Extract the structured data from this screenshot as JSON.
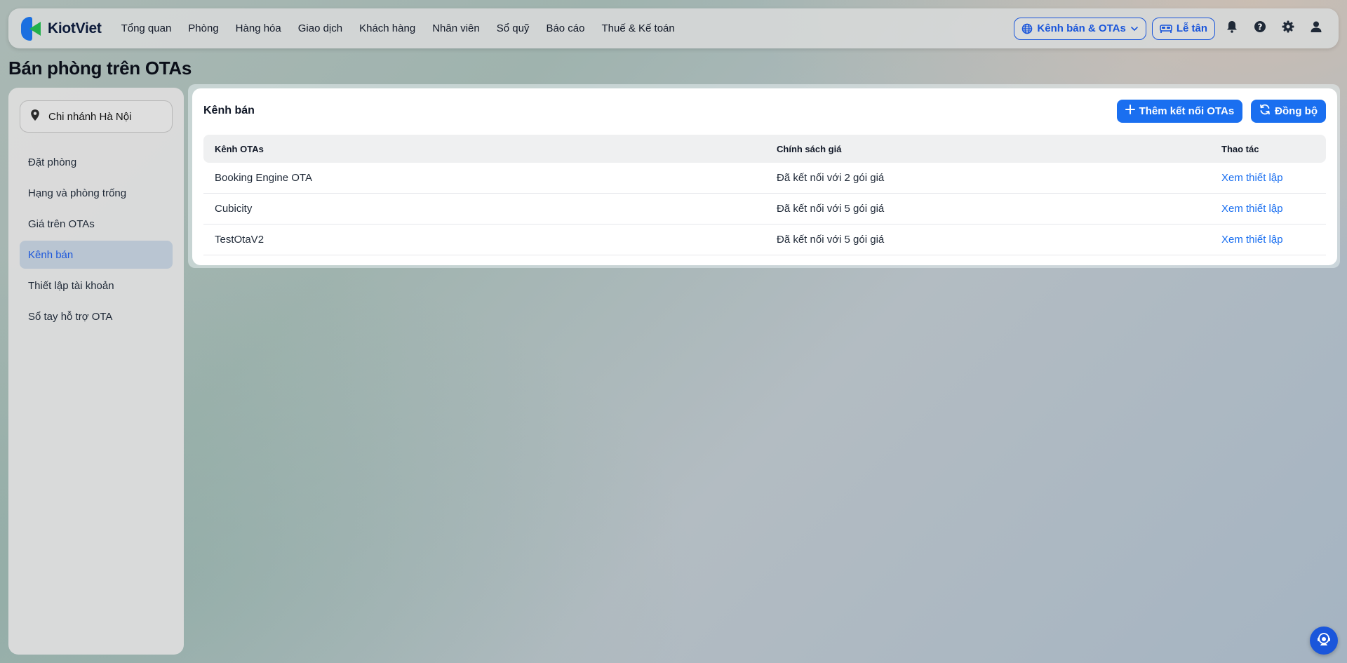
{
  "app": {
    "name": "KiotViet"
  },
  "nav": {
    "items": [
      "Tổng quan",
      "Phòng",
      "Hàng hóa",
      "Giao dịch",
      "Khách hàng",
      "Nhân viên",
      "Sổ quỹ",
      "Báo cáo",
      "Thuế & Kế toán"
    ]
  },
  "topright": {
    "channel_label": "Kênh bán & OTAs",
    "reception_label": "Lễ tân"
  },
  "page": {
    "title": "Bán phòng trên OTAs"
  },
  "sidebar": {
    "branch": "Chi nhánh Hà Nội",
    "items": [
      "Đặt phòng",
      "Hạng và phòng trống",
      "Giá trên OTAs",
      "Kênh bán",
      "Thiết lập tài khoản",
      "Sổ tay hỗ trợ OTA"
    ],
    "active_index": 3
  },
  "main": {
    "title": "Kênh bán",
    "add_button": "Thêm kết nối OTAs",
    "sync_button": "Đồng bộ",
    "columns": [
      "Kênh OTAs",
      "Chính sách giá",
      "Thao tác"
    ],
    "rows": [
      {
        "channel": "Booking Engine OTA",
        "policy": "Đã kết nối với 2 gói giá",
        "action": "Xem thiết lập"
      },
      {
        "channel": "Cubicity",
        "policy": "Đã kết nối với 5 gói giá",
        "action": "Xem thiết lập"
      },
      {
        "channel": "TestOtaV2",
        "policy": "Đã kết nối với 5 gói giá",
        "action": "Xem thiết lập"
      }
    ]
  },
  "colors": {
    "accent": "#1a6ff0",
    "active_bg": "#b9c5d2"
  },
  "icons": [
    "location-pin-icon",
    "globe-icon",
    "chevron-down-icon",
    "bed-icon",
    "bell-icon",
    "help-icon",
    "gear-icon",
    "user-icon",
    "plus-icon",
    "sync-icon",
    "support-chat-icon"
  ]
}
